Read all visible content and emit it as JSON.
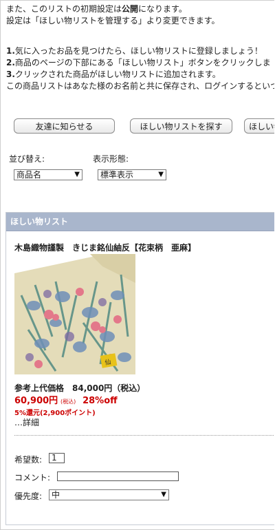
{
  "intro": {
    "line1_pre": "また、このリストの初期設定は",
    "line1_bold": "公開",
    "line1_post": "になります。",
    "line2": "設定は「ほしい物リストを管理する」より変更できます。",
    "step1_num": "1.",
    "step1_text": "気に入ったお品を見つけたら、ほしい物リストに登録しましょう！",
    "step2_num": "2.",
    "step2_text": "商品のページの下部にある「ほしい物リスト」ボタンをクリックしま",
    "step3_num": "3.",
    "step3_text": "クリックされた商品がほしい物リストに追加されます。",
    "line_last": "この商品リストはあなた様のお名前と共に保存され、ログインするといつで"
  },
  "buttons": {
    "tell_friend": "友達に知らせる",
    "find_list": "ほしい物リストを探す",
    "more": "ほしい物"
  },
  "sort": {
    "label": "並び替え:",
    "value": "商品名"
  },
  "display": {
    "label": "表示形態:",
    "value": "標準表示"
  },
  "panel": {
    "title": "ほしい物リスト",
    "product_title": "木島織物謹製　きじま銘仙紬反【花束柄　亜麻】",
    "list_price": "参考上代価格　84,000円（税込）",
    "sale_price": "60,900円",
    "tax_note": "(税込)",
    "discount": "28%off",
    "reward": "5%還元(2,900ポイント)",
    "detail_link": "…詳細",
    "qty_label": "希望数:",
    "qty_value": "1",
    "comment_label": "コメント:",
    "comment_value": "",
    "priority_label": "優先度:",
    "priority_value": "中"
  },
  "colors": {
    "panel_header": "#a9b6cc",
    "price_red": "#cc0000"
  },
  "icons": {
    "dropdown": "chevron-down-icon"
  }
}
